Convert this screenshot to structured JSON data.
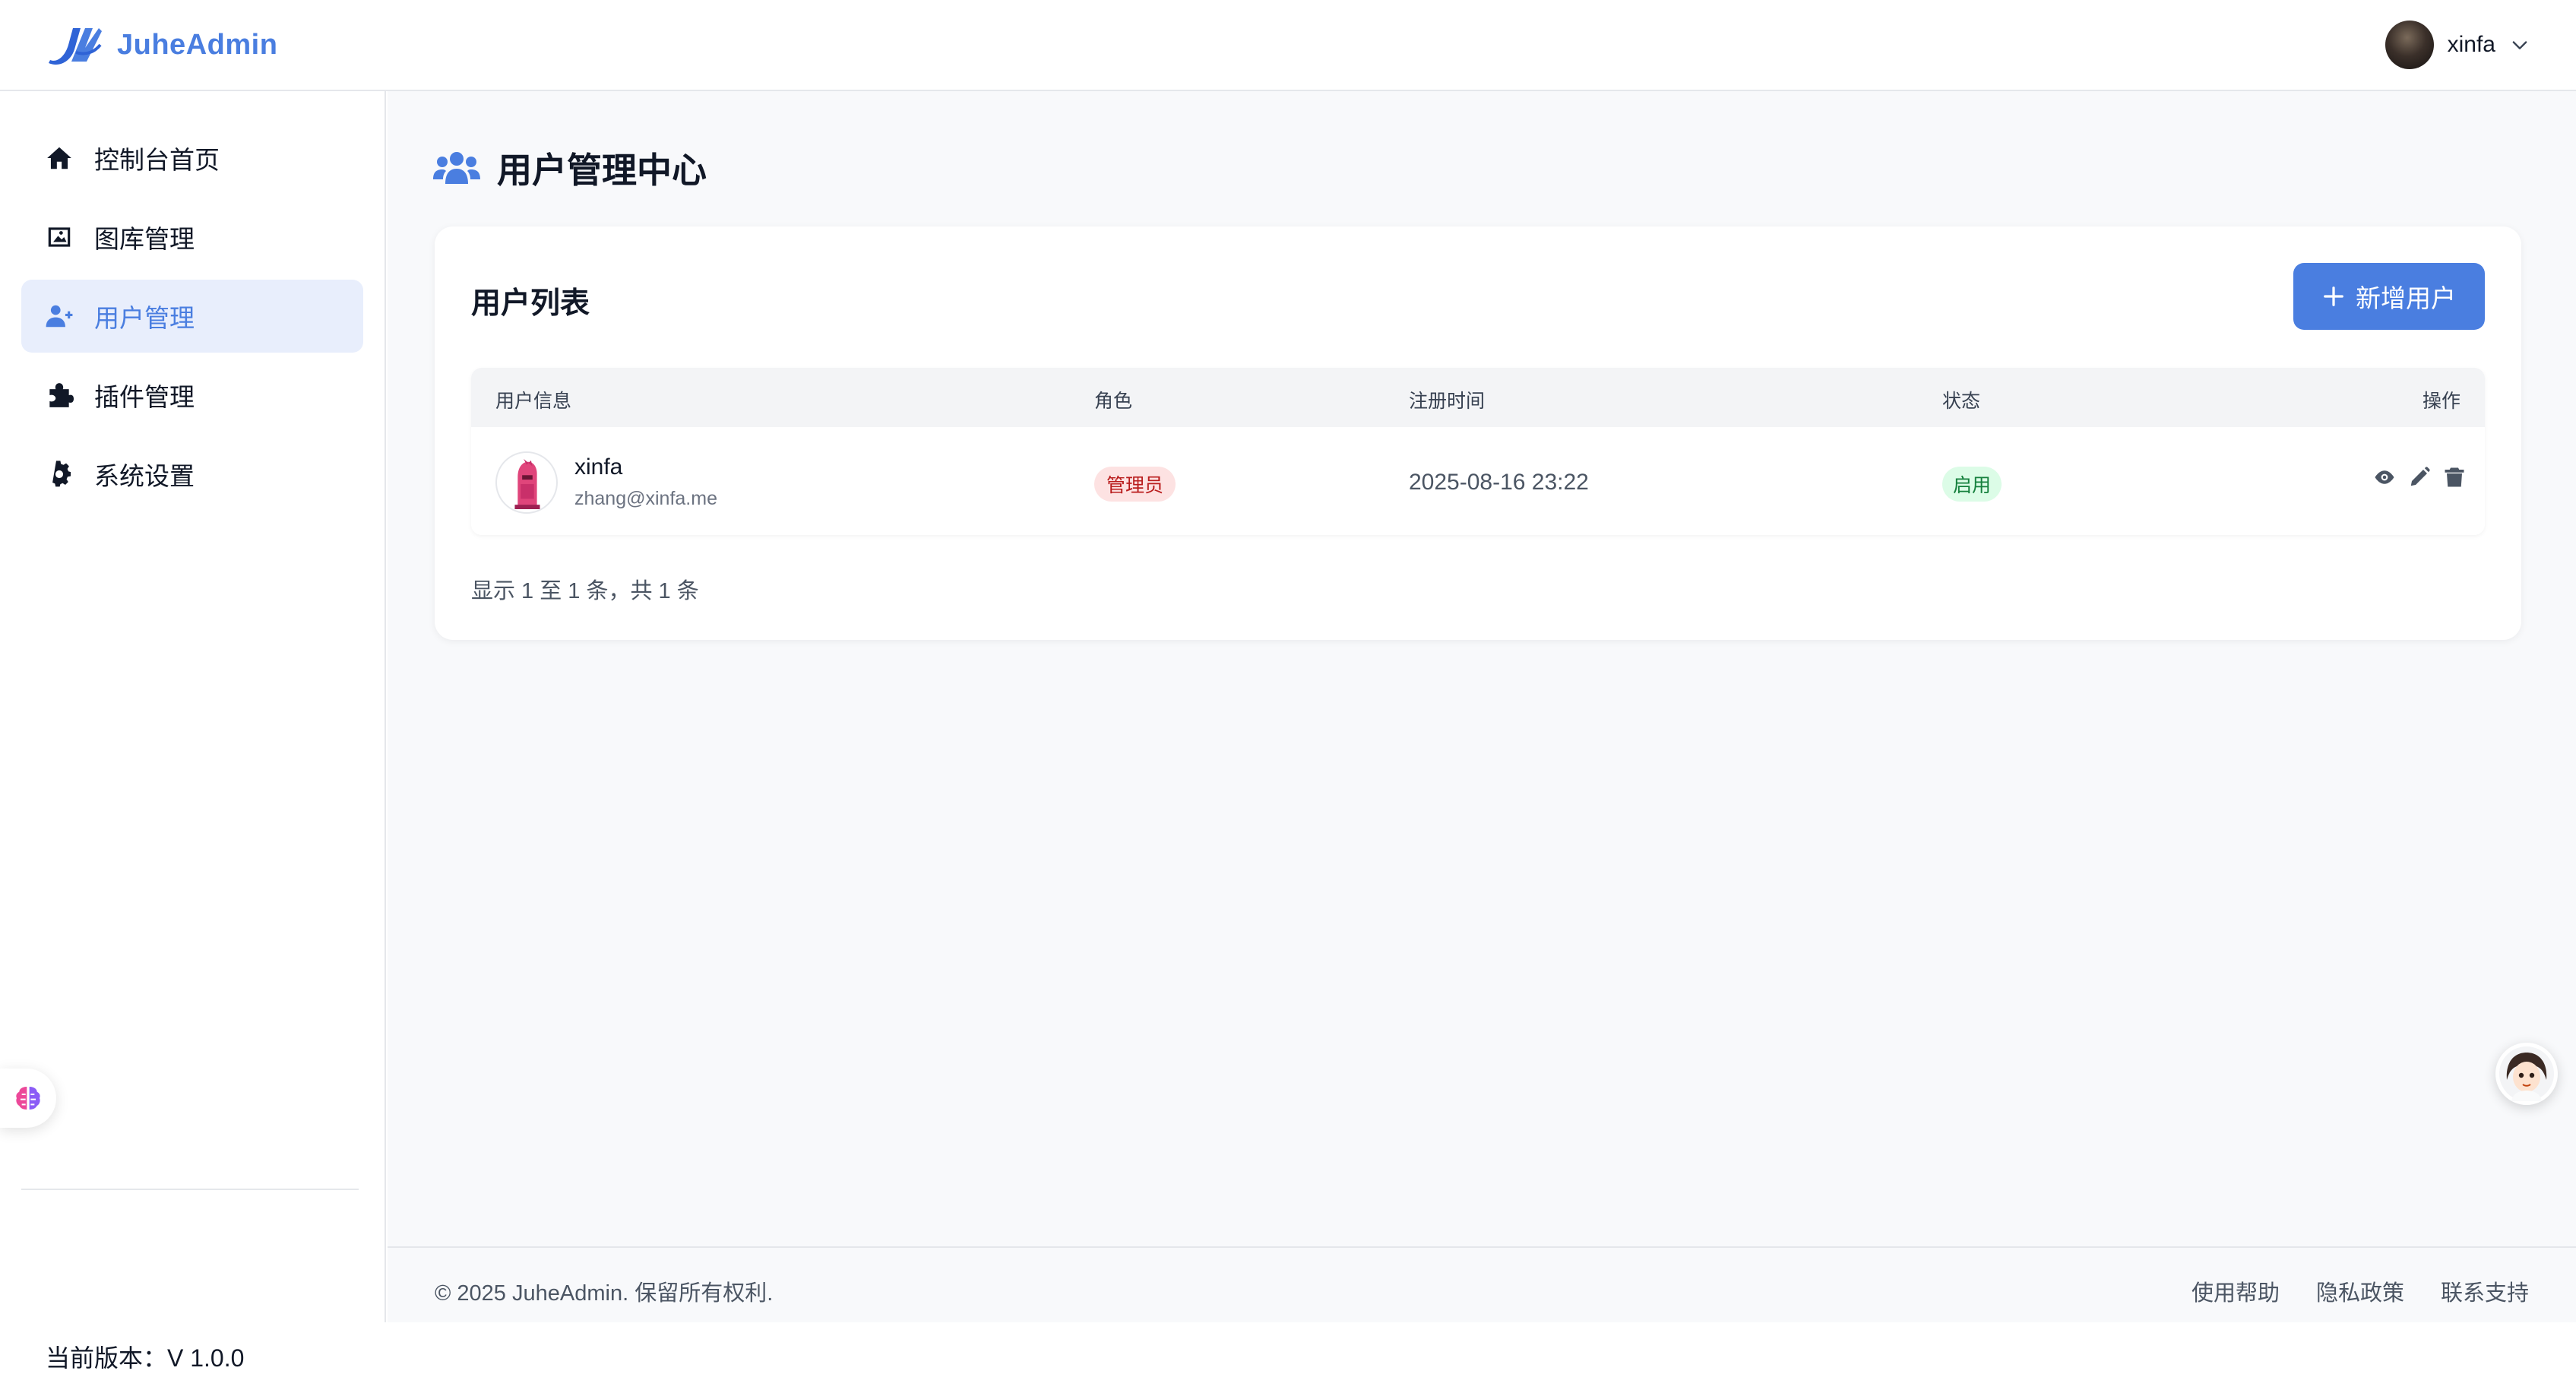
{
  "app": {
    "brand_name": "JuheAdmin",
    "brand_color": "#4a7ee0"
  },
  "header": {
    "user_name": "xinfa"
  },
  "sidebar": {
    "items": [
      {
        "label": "控制台首页",
        "icon": "home-icon"
      },
      {
        "label": "图库管理",
        "icon": "image-icon"
      },
      {
        "label": "用户管理",
        "icon": "user-plus-icon",
        "active": true
      },
      {
        "label": "插件管理",
        "icon": "puzzle-icon"
      },
      {
        "label": "系统设置",
        "icon": "gear-icon"
      }
    ],
    "version_label": "当前版本：V 1.0.0"
  },
  "main": {
    "page_title": "用户管理中心",
    "card_title": "用户列表",
    "add_button_label": "新增用户",
    "table": {
      "columns": [
        "用户信息",
        "角色",
        "注册时间",
        "状态",
        "操作"
      ],
      "rows": [
        {
          "name": "xinfa",
          "email": "zhang@xinfa.me",
          "role": "管理员",
          "registered": "2025-08-16 23:22",
          "status": "启用",
          "actions": [
            "view-icon",
            "edit-icon",
            "delete-icon"
          ]
        }
      ]
    },
    "pagination_text": "显示 1 至 1 条，共 1 条"
  },
  "footer": {
    "copyright": "© 2025 JuheAdmin. 保留所有权利.",
    "links": [
      "使用帮助",
      "隐私政策",
      "联系支持"
    ]
  },
  "colors": {
    "accent": "#4a7ee0",
    "active_nav_bg": "#e8eefc",
    "role_badge_bg": "#fde2e2",
    "role_badge_text": "#b91c1c",
    "status_badge_bg": "#dcfce7",
    "status_badge_text": "#15803d"
  }
}
